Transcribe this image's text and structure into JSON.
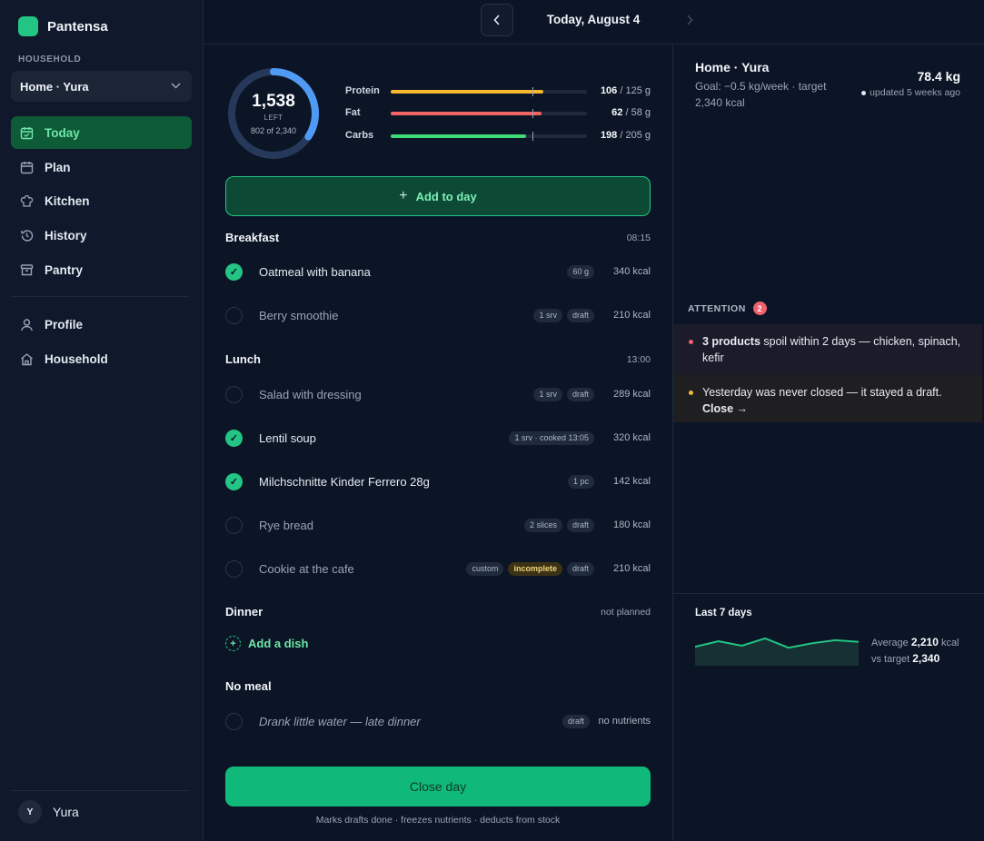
{
  "app": {
    "name": "Pantensa"
  },
  "sidebar": {
    "section_label": "HOUSEHOLD",
    "household_select": "Home · Yura",
    "nav_main": [
      {
        "label": "Today",
        "icon": "calendar-icon",
        "active": true
      },
      {
        "label": "Plan",
        "icon": "calendar-grid-icon",
        "active": false
      },
      {
        "label": "Kitchen",
        "icon": "chef-hat-icon",
        "active": false
      },
      {
        "label": "History",
        "icon": "history-icon",
        "active": false
      },
      {
        "label": "Pantry",
        "icon": "archive-box-icon",
        "active": false
      }
    ],
    "nav_secondary": [
      {
        "label": "Profile",
        "icon": "user-icon"
      },
      {
        "label": "Household",
        "icon": "home-icon"
      }
    ],
    "user": {
      "initial": "Y",
      "name": "Yura"
    }
  },
  "topbar": {
    "date": "Today, August 4"
  },
  "summary": {
    "left_value": "1,538",
    "left_label": "LEFT",
    "consumed": "802 of 2,340",
    "consumed_fraction": 0.343,
    "macros": [
      {
        "name": "Protein",
        "value": "106",
        "target": "/ 125 g",
        "color": "#f5b82e",
        "fill": 0.78,
        "tick": 0.72
      },
      {
        "name": "Fat",
        "value": "62",
        "target": "/ 58 g",
        "color": "#f26464",
        "fill": 0.77,
        "tick": 0.72
      },
      {
        "name": "Carbs",
        "value": "198",
        "target": "/ 205 g",
        "color": "#3ddc78",
        "fill": 0.69,
        "tick": 0.72
      }
    ]
  },
  "actions": {
    "add_to_day": "Add to day",
    "add_dish": "Add a dish",
    "close_day": "Close day",
    "close_note": "Marks drafts done · freezes nutrients · deducts from stock"
  },
  "meals": {
    "breakfast": {
      "name": "Breakfast",
      "time": "08:15",
      "items": [
        {
          "name": "Oatmeal with banana",
          "tags": [
            "60 g"
          ],
          "kcal": "340 kcal",
          "done": true
        },
        {
          "name": "Berry smoothie",
          "tags": [
            "1 srv",
            "draft"
          ],
          "kcal": "210 kcal",
          "done": false
        }
      ]
    },
    "lunch": {
      "name": "Lunch",
      "time": "13:00",
      "items": [
        {
          "name": "Salad with dressing",
          "tags": [
            "1 srv",
            "draft"
          ],
          "kcal": "289 kcal",
          "done": false
        },
        {
          "name": "Lentil soup",
          "tags": [
            "1 srv · cooked 13:05"
          ],
          "kcal": "320 kcal",
          "done": true
        },
        {
          "name": "Milchschnitte Kinder Ferrero 28g",
          "tags": [
            "1 pc"
          ],
          "kcal": "142 kcal",
          "done": true
        },
        {
          "name": "Rye bread",
          "tags": [
            "2 slices",
            "draft"
          ],
          "kcal": "180 kcal",
          "done": false
        },
        {
          "name": "Cookie at the cafe",
          "tags": [
            "custom",
            "incomplete",
            "draft"
          ],
          "kcal": "210 kcal",
          "done": false
        }
      ]
    },
    "dinner": {
      "name": "Dinner",
      "time": "not planned"
    },
    "no_meal": {
      "name": "No meal",
      "items": [
        {
          "name": "Drank little water — late dinner",
          "tags": [
            "draft"
          ],
          "kcal": "no nutrients",
          "done": false
        }
      ]
    }
  },
  "profile": {
    "name": "Home · Yura",
    "goal": "Goal: −0.5 kg/week · target 2,340 kcal",
    "weight": "78.4 kg",
    "updated": "updated 5 weeks ago"
  },
  "attention": {
    "label": "ATTENTION",
    "count": "2",
    "alerts": [
      {
        "bold": "3 products",
        "text": " spoil within 2 days — chicken, spinach, kefir",
        "color": "#f0616d"
      },
      {
        "text": "Yesterday was never closed — it stayed a draft. ",
        "link": "Close →",
        "color": "#f5b82e"
      }
    ]
  },
  "trend": {
    "label": "Last 7 days",
    "avg_prefix": "Average",
    "average": "2,210",
    "unit": "kcal",
    "vs_prefix": "vs target",
    "target": "2,340",
    "chart_data": {
      "type": "area",
      "values": [
        2150,
        2310,
        2180,
        2390,
        2120,
        2250,
        2340,
        2290
      ],
      "ylim": [
        1600,
        2600
      ]
    }
  }
}
